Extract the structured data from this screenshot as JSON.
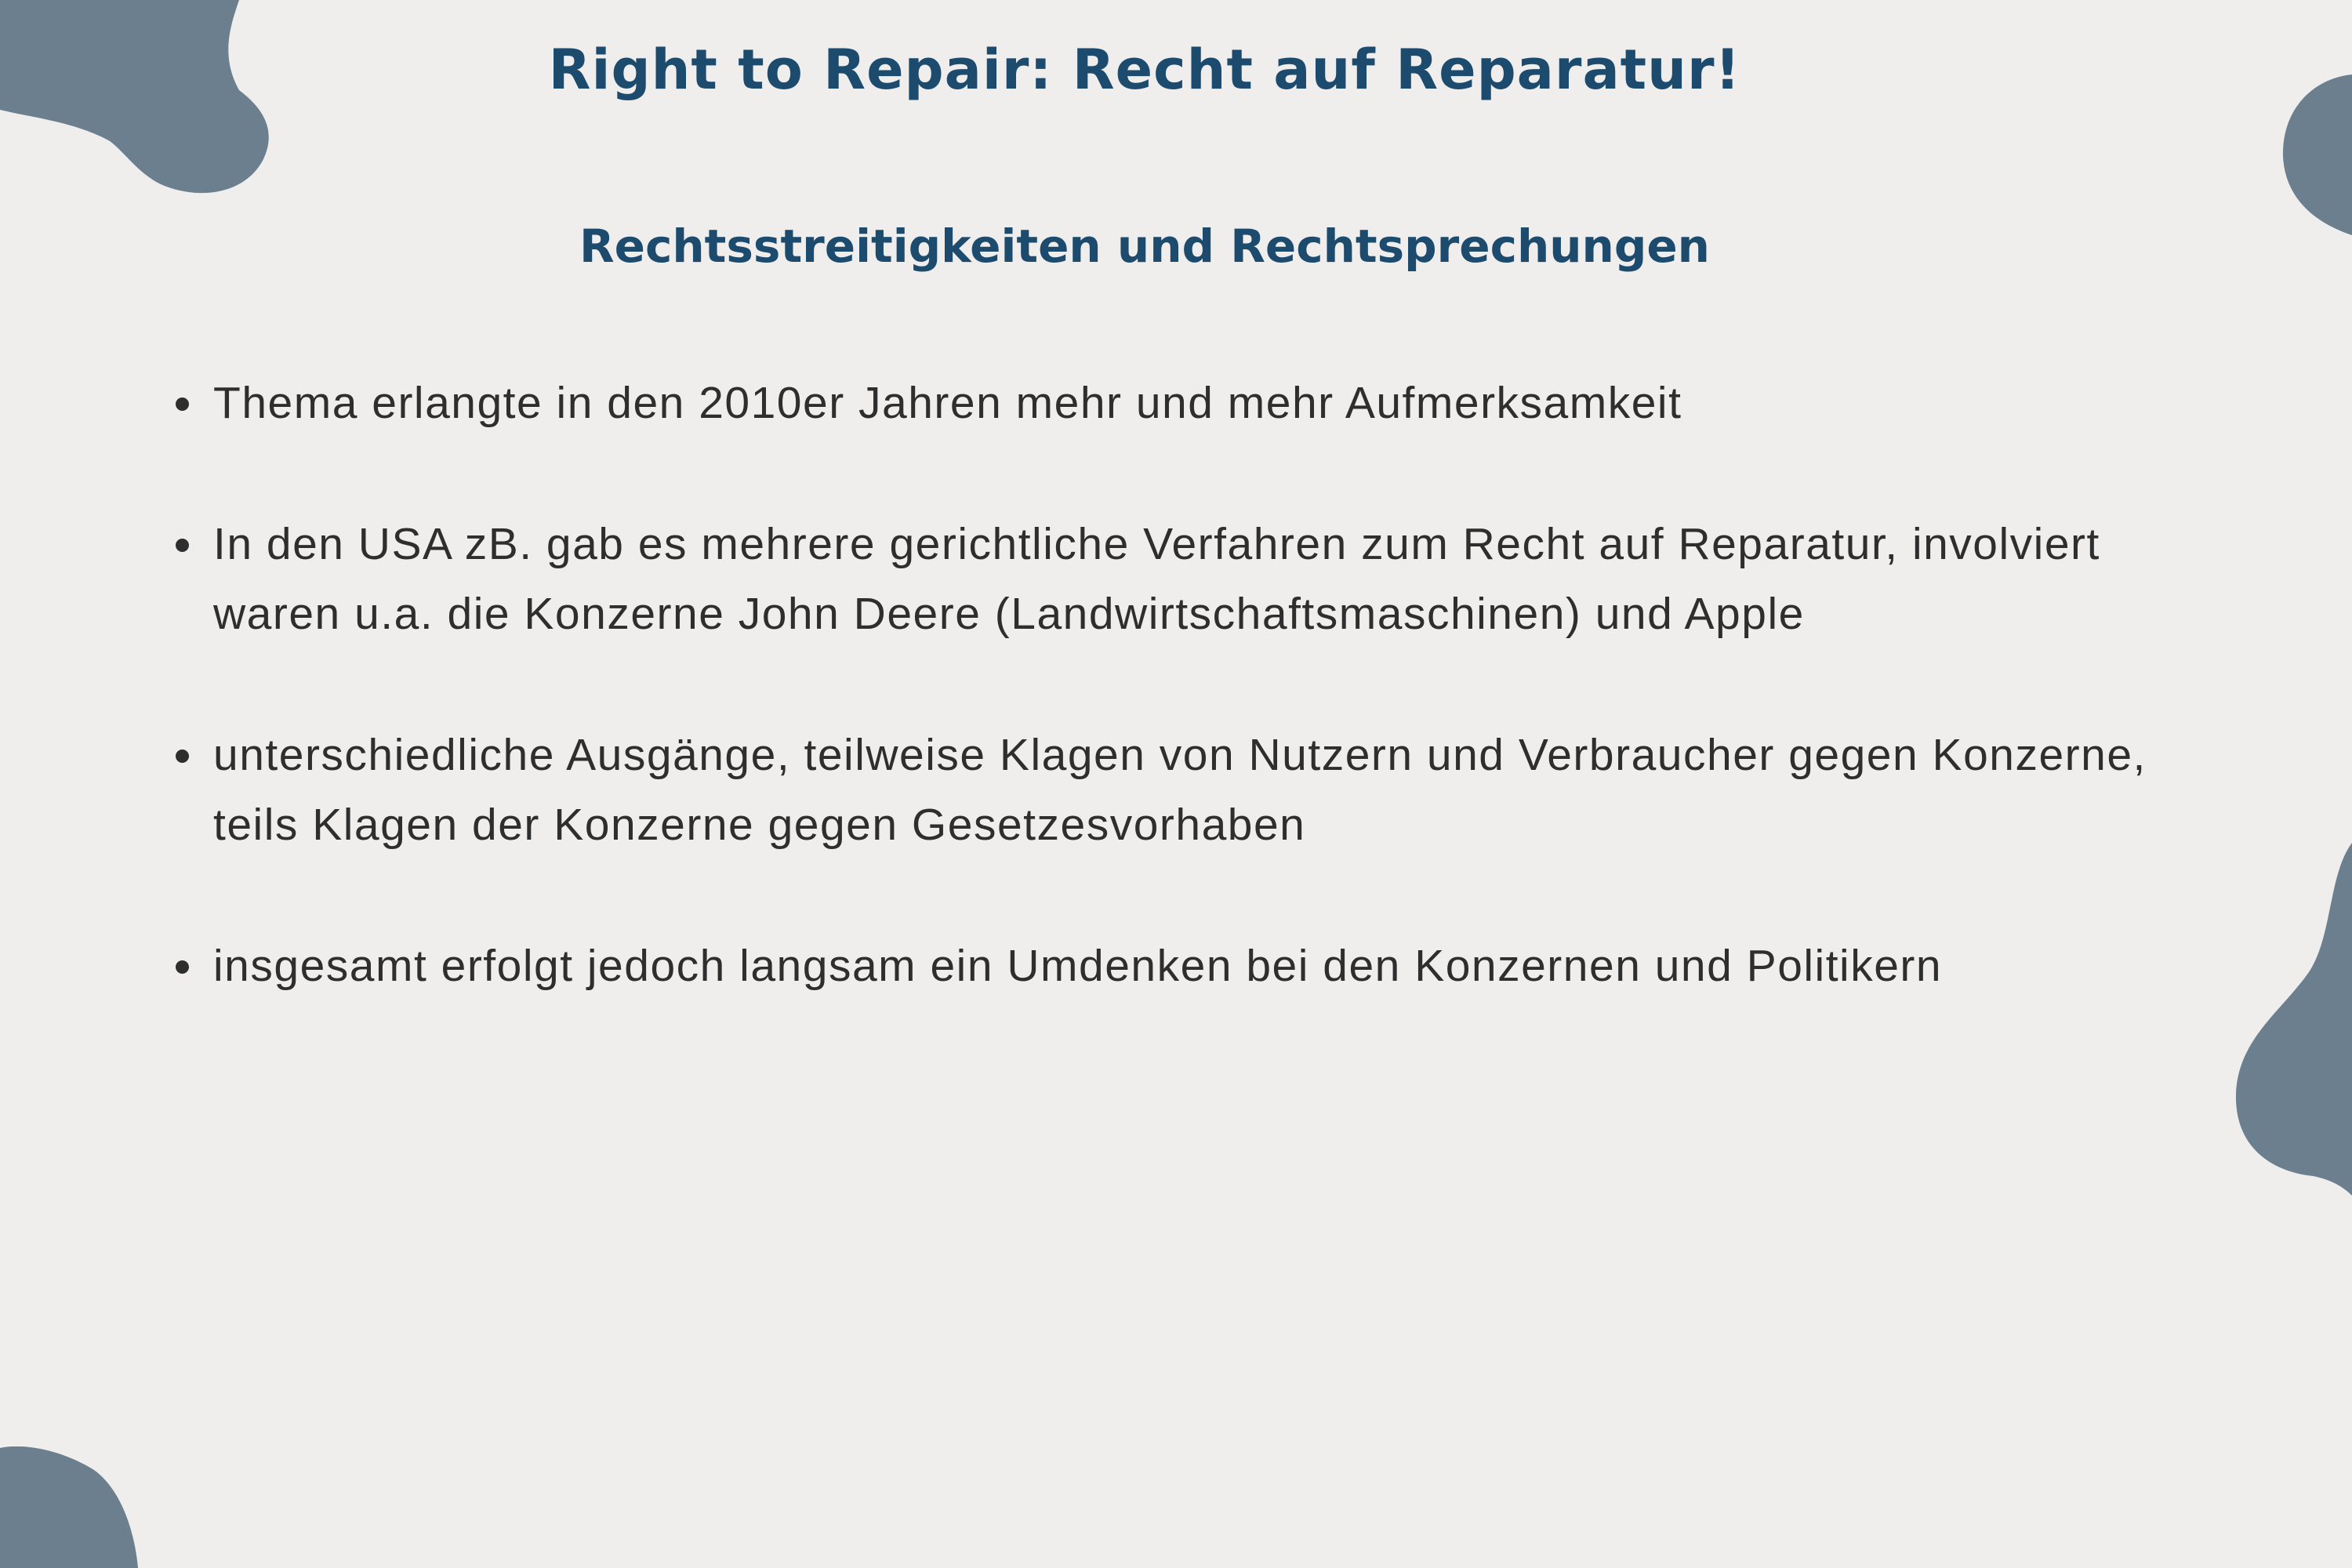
{
  "slide": {
    "title": "Right to Repair: Recht auf Reparatur!",
    "subtitle": "Rechtsstreitigkeiten und Rechtsprechungen",
    "bullets": [
      "Thema erlangte in den 2010er Jahren mehr und mehr Aufmerksamkeit",
      "In den USA zB. gab es mehrere gerichtliche Verfahren zum Recht auf Reparatur, involviert waren u.a. die Konzerne John Deere (Landwirtschaftsmaschinen) und Apple",
      "unterschiedliche Ausgänge, teilweise Klagen von Nutzern und Verbraucher gegen Konzerne, teils Klagen der Konzerne gegen Gesetzesvorhaben",
      "insgesamt erfolgt jedoch langsam ein Umdenken bei den Konzernen und Politikern"
    ]
  },
  "colors": {
    "background": "#f0eeed",
    "heading": "#1d4b6e",
    "body_text": "#2e2e2e",
    "blob": "#6b7f8e"
  }
}
